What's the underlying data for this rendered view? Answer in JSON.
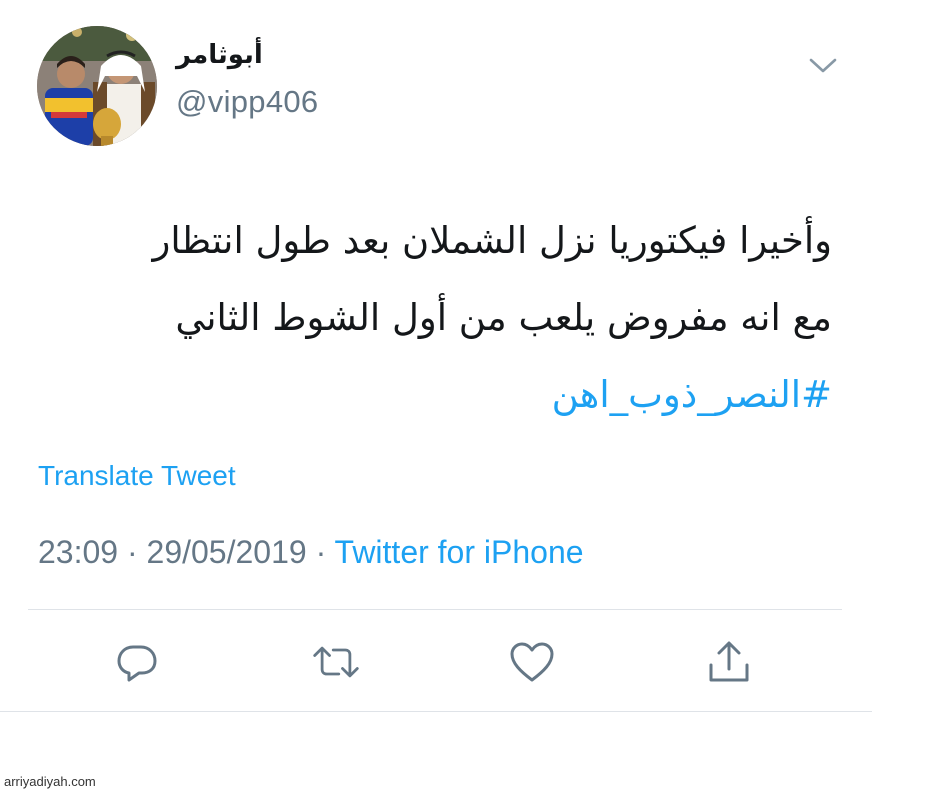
{
  "user": {
    "display_name": "أبوثامر",
    "handle": "@vipp406"
  },
  "tweet": {
    "lines": [
      "وأخيرا فيكتوريا نزل الشملان بعد طول انتظار",
      "مع انه مفروض يلعب من أول الشوط الثاني"
    ],
    "hashtag": "#النصر_ذوب_اهن",
    "translate_label": "Translate Tweet",
    "time": "23:09",
    "date": "29/05/2019",
    "separator": " · ",
    "source": "Twitter for iPhone"
  },
  "actions": [
    {
      "icon": "reply-icon"
    },
    {
      "icon": "retweet-icon"
    },
    {
      "icon": "like-icon"
    },
    {
      "icon": "share-icon"
    }
  ],
  "watermark": "arriyadiyah.com",
  "colors": {
    "accent": "#1da1f2",
    "text": "#14171a",
    "secondary": "#657786",
    "icon": "#657786",
    "divider": "#dfe3e8"
  }
}
